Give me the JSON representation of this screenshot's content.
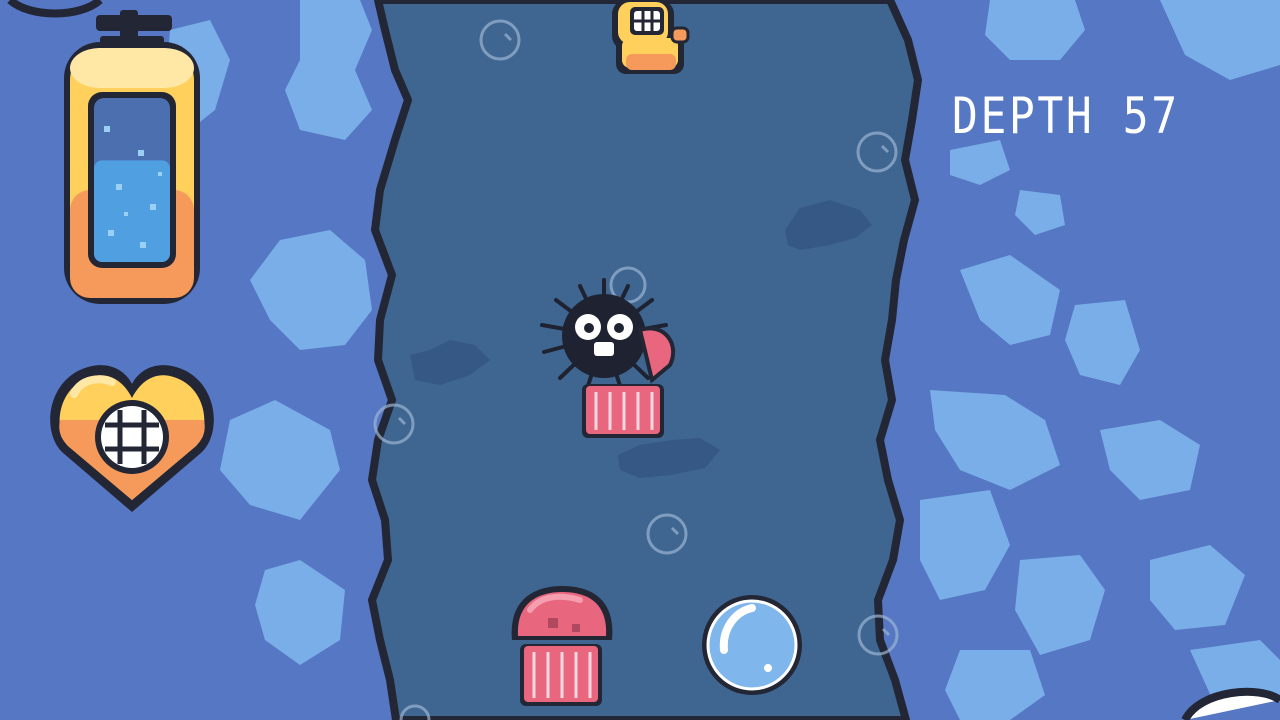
{
  "hud": {
    "depth_label": "DEPTH 57",
    "oxygen_level": 0.62,
    "lives_indicator": "diver-helmet-heart-icon"
  },
  "entities": {
    "player": "diver-icon",
    "enemies": [
      "sea-urchin-icon",
      "jellyfish-icon",
      "jellyfish-icon"
    ],
    "pickups": [
      "air-bubble-icon"
    ]
  },
  "colors": {
    "rock": "#5677c4",
    "rock_highlight": "#79aee8",
    "water": "#3e6690",
    "outline": "#232634",
    "accent_yellow": "#ffd15c",
    "accent_orange": "#f59a5b",
    "jelly_pink": "#e9667f"
  }
}
